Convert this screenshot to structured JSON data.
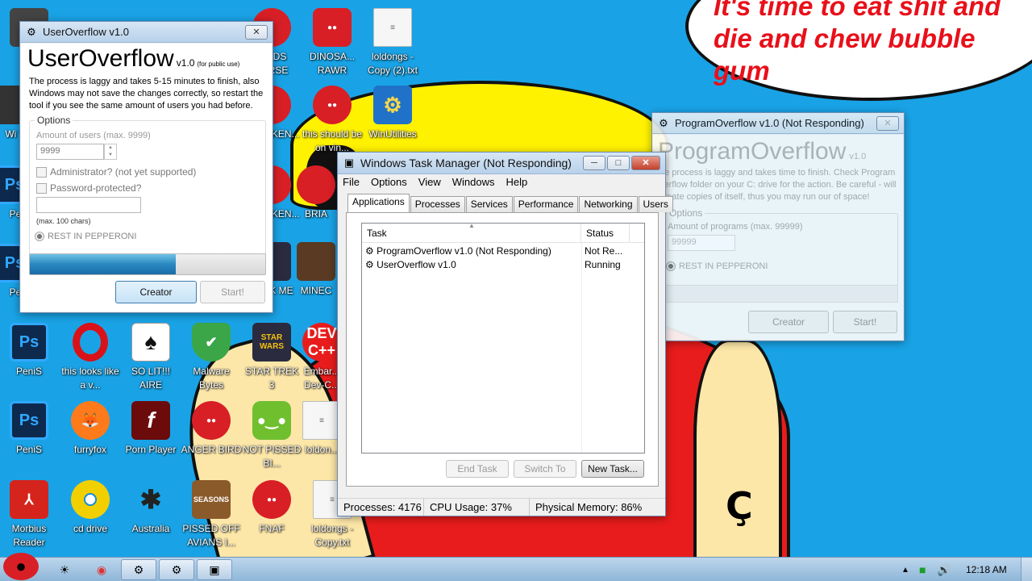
{
  "desktop": {
    "speech_text": "It's time to eat shit and die and chew bubble gum",
    "icons": [
      {
        "label": "PeniS",
        "icon": "photoshop-icon"
      },
      {
        "label": "this looks like a v...",
        "icon": "opera-icon"
      },
      {
        "label": "SO LIT!!! AIRE",
        "icon": "solitaire-icon"
      },
      {
        "label": "Malware Bytes",
        "icon": "shield-icon"
      },
      {
        "label": "STAR TREK 3",
        "icon": "star-wars-icon"
      },
      {
        "label": "Embar... Dev-C...",
        "icon": "devcpp-icon"
      },
      {
        "label": "PeniS",
        "icon": "photoshop-icon"
      },
      {
        "label": "furryfox",
        "icon": "firefox-icon"
      },
      {
        "label": "Porn Player",
        "icon": "flash-icon"
      },
      {
        "label": "ANGER BIRD",
        "icon": "angry-bird-icon"
      },
      {
        "label": "NOT PISSED BI...",
        "icon": "pig-icon"
      },
      {
        "label": "loldon...",
        "icon": "text-file-icon"
      },
      {
        "label": "Morbius Reader",
        "icon": "pdf-icon"
      },
      {
        "label": "cd drive",
        "icon": "cd-icon"
      },
      {
        "label": "Australia",
        "icon": "spider-icon"
      },
      {
        "label": "PISSED OFF AVIANS I...",
        "icon": "seasons-icon"
      },
      {
        "label": "FNAF",
        "icon": "angry-bird-icon"
      },
      {
        "label": "loldongs - Copy.txt",
        "icon": "text-file-icon"
      },
      {
        "label": "DINOSA... RAWR",
        "icon": "angry-bird-icon"
      },
      {
        "label": "loldongs - Copy (2).txt",
        "icon": "text-file-icon"
      },
      {
        "label": "this should be on vin...",
        "icon": "angry-bird-icon"
      },
      {
        "label": "WinUtilities",
        "icon": "gear-icon"
      },
      {
        "label": "BIRDS VERSE",
        "icon": "angry-bird-icon"
      },
      {
        "label": "ATED KEN...",
        "icon": "angry-bird-icon"
      },
      {
        "label": "ATED KEN...",
        "icon": "angry-bird-icon"
      },
      {
        "label": "BRIA",
        "icon": "angry-bird-icon"
      },
      {
        "label": "TREK ME",
        "icon": "star-wars-icon"
      },
      {
        "label": "MINEC",
        "icon": "minecraft-icon"
      },
      {
        "label": "m",
        "icon": "app-icon"
      },
      {
        "label": "Wi V",
        "icon": "app-icon"
      },
      {
        "label": "Pe",
        "icon": "photoshop-icon"
      },
      {
        "label": "Pe",
        "icon": "photoshop-icon"
      }
    ]
  },
  "useroverflow": {
    "title": "UserOverflow v1.0",
    "heading": "UserOverflow",
    "version": "v1.0",
    "public": "(for public use)",
    "description": "The process is laggy and takes 5-15 minutes to finish, also Windows may not save the changes correctly, so restart the tool if you see the same amount of users you had before.",
    "options_label": "Options",
    "amount_label": "Amount of users (max. 9999)",
    "amount_value": "9999",
    "admin_label": "Administrator? (not yet supported)",
    "password_label": "Password-protected?",
    "max_chars": "(max. 100 chars)",
    "radio_label": "REST IN PEPPERONI",
    "progress": 0.62,
    "creator_button": "Creator",
    "start_button": "Start!"
  },
  "programoverflow": {
    "title": "ProgramOverflow v1.0 (Not Responding)",
    "heading": "ProgramOverflow",
    "version": "v1.0",
    "description": "he process is laggy and takes time to finish. Check Program verflow folder on your C: drive for the action. Be careful - will create copies of itself, thus you may run our of space!",
    "options_label": "Options",
    "amount_label": "Amount of programs (max. 99999)",
    "amount_value": "99999",
    "radio_label": "REST IN PEPPERONI",
    "creator_button": "Creator",
    "start_button": "Start!"
  },
  "taskmanager": {
    "title": "Windows Task Manager (Not Responding)",
    "menu": [
      "File",
      "Options",
      "View",
      "Windows",
      "Help"
    ],
    "tabs": [
      "Applications",
      "Processes",
      "Services",
      "Performance",
      "Networking",
      "Users"
    ],
    "columns": [
      "Task",
      "Status"
    ],
    "rows": [
      {
        "task": "ProgramOverflow v1.0 (Not Responding)",
        "status": "Not Re..."
      },
      {
        "task": "UserOverflow v1.0",
        "status": "Running"
      }
    ],
    "end_task": "End Task",
    "switch_to": "Switch To",
    "new_task": "New Task...",
    "status": {
      "processes": "Processes: 4176",
      "cpu": "CPU Usage: 37%",
      "memory": "Physical Memory: 86%"
    }
  },
  "taskbar": {
    "clock": "12:18 AM"
  }
}
